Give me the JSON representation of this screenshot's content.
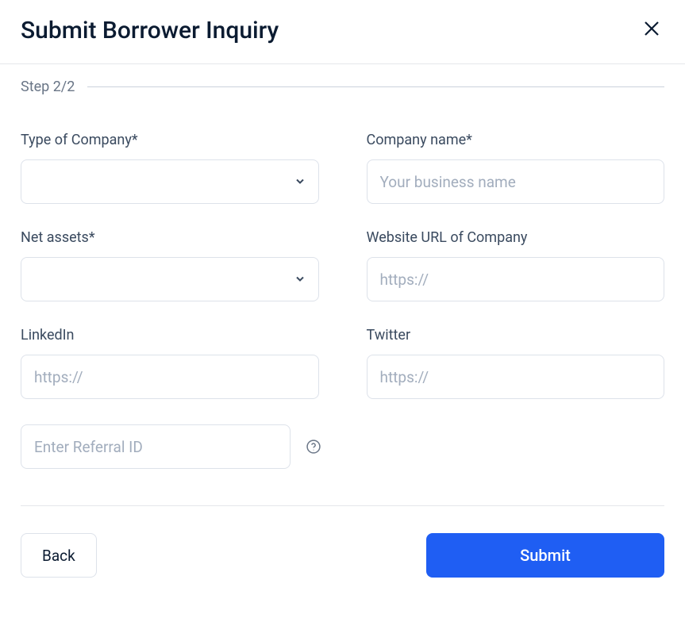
{
  "header": {
    "title": "Submit Borrower Inquiry"
  },
  "step": {
    "label": "Step 2/2"
  },
  "fields": {
    "company_type": {
      "label": "Type of Company*",
      "value": ""
    },
    "company_name": {
      "label": "Company name*",
      "placeholder": "Your business name",
      "value": ""
    },
    "net_assets": {
      "label": "Net assets*",
      "value": ""
    },
    "website": {
      "label": "Website URL of Company",
      "placeholder": "https://",
      "value": ""
    },
    "linkedin": {
      "label": "LinkedIn",
      "placeholder": "https://",
      "value": ""
    },
    "twitter": {
      "label": "Twitter",
      "placeholder": "https://",
      "value": ""
    },
    "referral": {
      "placeholder": "Enter Referral ID",
      "value": ""
    }
  },
  "actions": {
    "back": "Back",
    "submit": "Submit"
  }
}
